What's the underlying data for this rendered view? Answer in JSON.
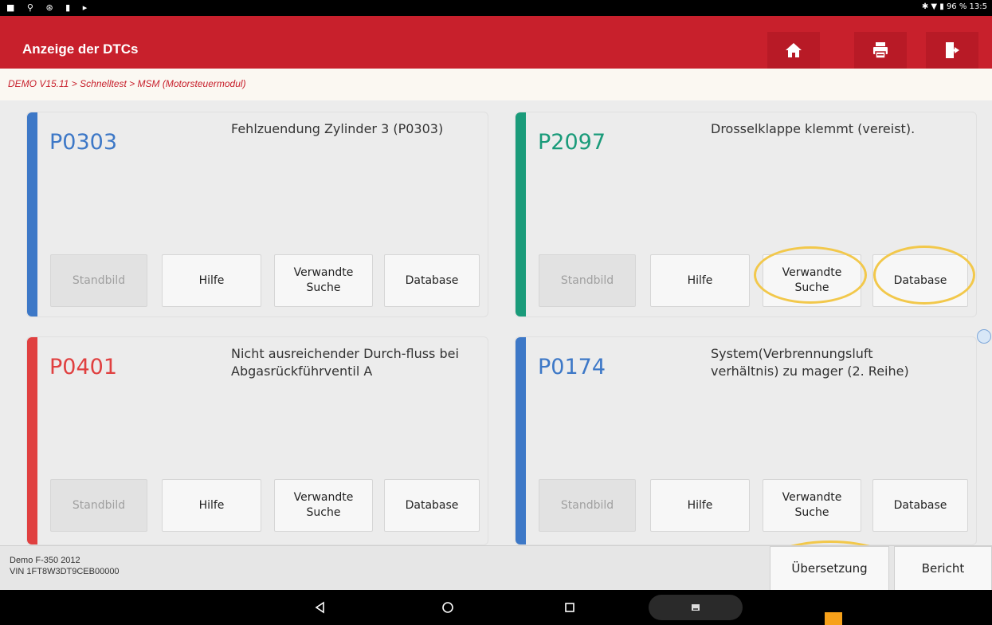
{
  "header": {
    "title": "Anzeige der DTCs",
    "breadcrumb": "DEMO V15.11 > Schnelltest > MSM (Motorsteuermodul)",
    "icons": [
      "home-icon",
      "print-icon",
      "exit-icon"
    ]
  },
  "status_bar": {
    "time": "13:5",
    "battery": "96 %"
  },
  "colors": {
    "header": "#c8202c",
    "blue": "#3d78c7",
    "green": "#1a9b7a",
    "red": "#e04040",
    "highlight": "#f2c84b"
  },
  "dtcs": [
    {
      "code": "P0303",
      "desc": "Fehlzuendung Zylinder 3 (P0303)",
      "color": "#3d78c7"
    },
    {
      "code": "P2097",
      "desc": "Drosselklappe klemmt (vereist).",
      "color": "#1a9b7a"
    },
    {
      "code": "P0401",
      "desc": "Nicht ausreichender Durch-fluss bei Abgasrückführventil A",
      "color": "#e04040"
    },
    {
      "code": "P0174",
      "desc": "System(Verbrennungsluft verhältnis) zu mager (2. Reihe)",
      "color": "#3d78c7"
    }
  ],
  "buttons": {
    "freeze": "Standbild",
    "help": "Hilfe",
    "related_1": "Verwandte",
    "related_2": "Suche",
    "database": "Database"
  },
  "footer": {
    "vehicle": "Demo F-350 2012",
    "vin": "VIN 1FT8W3DT9CEB00000",
    "translate": "Übersetzung",
    "report": "Bericht"
  }
}
